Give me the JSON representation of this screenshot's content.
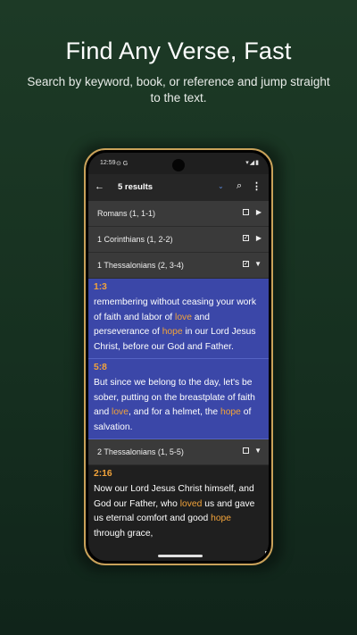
{
  "promo": {
    "title": "Find Any Verse, Fast",
    "subtitle": "Search by keyword, book, or reference and jump straight to the text."
  },
  "statusbar": {
    "time": "12:59",
    "left_icons": "⊙ G",
    "right_icons": "▾◢▮"
  },
  "appbar": {
    "back_icon": "←",
    "title": "5 results",
    "dropdown_icon": "⌄",
    "search_icon": "⌕",
    "more_icon": "⋮"
  },
  "groups": [
    {
      "label": "Romans (1, 1-1)",
      "checked": false,
      "arrow": "▶"
    },
    {
      "label": "1 Corinthians (1, 2-2)",
      "checked": true,
      "arrow": "▶"
    },
    {
      "label": "1 Thessalonians (2, 3-4)",
      "checked": true,
      "arrow": "▼"
    },
    {
      "label": "2 Thessalonians (1, 5-5)",
      "checked": false,
      "arrow": "▼"
    }
  ],
  "verses": [
    {
      "ref": "1:3",
      "parts": [
        "remembering without ceasing your work of faith and labor of ",
        "love",
        " and perseverance of ",
        "hope",
        " in our Lord Jesus Christ, before our God and Father."
      ]
    },
    {
      "ref": "5:8",
      "parts": [
        "But since we belong to the day, let's be sober, putting on the breastplate of faith and ",
        "love",
        ", and for a helmet, the ",
        "hope",
        " of salvation."
      ]
    },
    {
      "ref": "2:16",
      "parts": [
        "Now our Lord Jesus Christ himself, and God our Father, who ",
        "loved",
        " us and gave us eternal comfort and good ",
        "hope",
        " through grace,"
      ]
    }
  ],
  "colors": {
    "highlight": "#f2a33a",
    "selected_bg": "#3b47a8",
    "phone_frame": "#c9a25a"
  }
}
